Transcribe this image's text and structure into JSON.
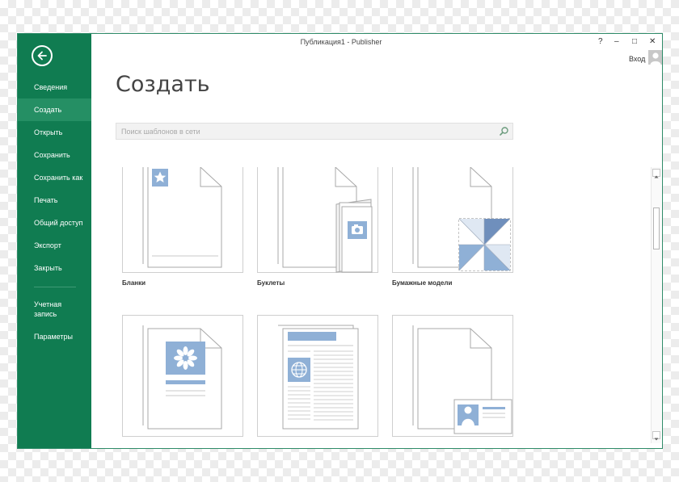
{
  "window": {
    "title": "Публикация1 - Publisher"
  },
  "controls": {
    "help": "?",
    "minimize": "–",
    "maximize": "□",
    "close": "✕"
  },
  "account": {
    "signin": "Вход"
  },
  "sidebar": {
    "items": [
      {
        "label": "Сведения"
      },
      {
        "label": "Создать"
      },
      {
        "label": "Открыть"
      },
      {
        "label": "Сохранить"
      },
      {
        "label": "Сохранить как"
      },
      {
        "label": "Печать"
      },
      {
        "label": "Общий доступ"
      },
      {
        "label": "Экспорт"
      },
      {
        "label": "Закрыть"
      },
      {
        "label": "Учетная запись"
      },
      {
        "label": "Параметры"
      }
    ],
    "active_index": 1
  },
  "main": {
    "title": "Создать",
    "search": {
      "placeholder": "Поиск шаблонов в сети",
      "value": ""
    },
    "templates": [
      {
        "label": "Бланки",
        "icon": "letterhead-star-icon"
      },
      {
        "label": "Буклеты",
        "icon": "brochure-camera-icon"
      },
      {
        "label": "Бумажные модели",
        "icon": "paper-model-pinwheel-icon"
      },
      {
        "label": "",
        "icon": "flyer-flower-icon"
      },
      {
        "label": "",
        "icon": "newsletter-globe-icon"
      },
      {
        "label": "",
        "icon": "business-card-person-icon"
      }
    ]
  },
  "colors": {
    "accent": "#107c51",
    "accent_active": "#258f64",
    "thumb_blue": "#8fb0d6"
  }
}
